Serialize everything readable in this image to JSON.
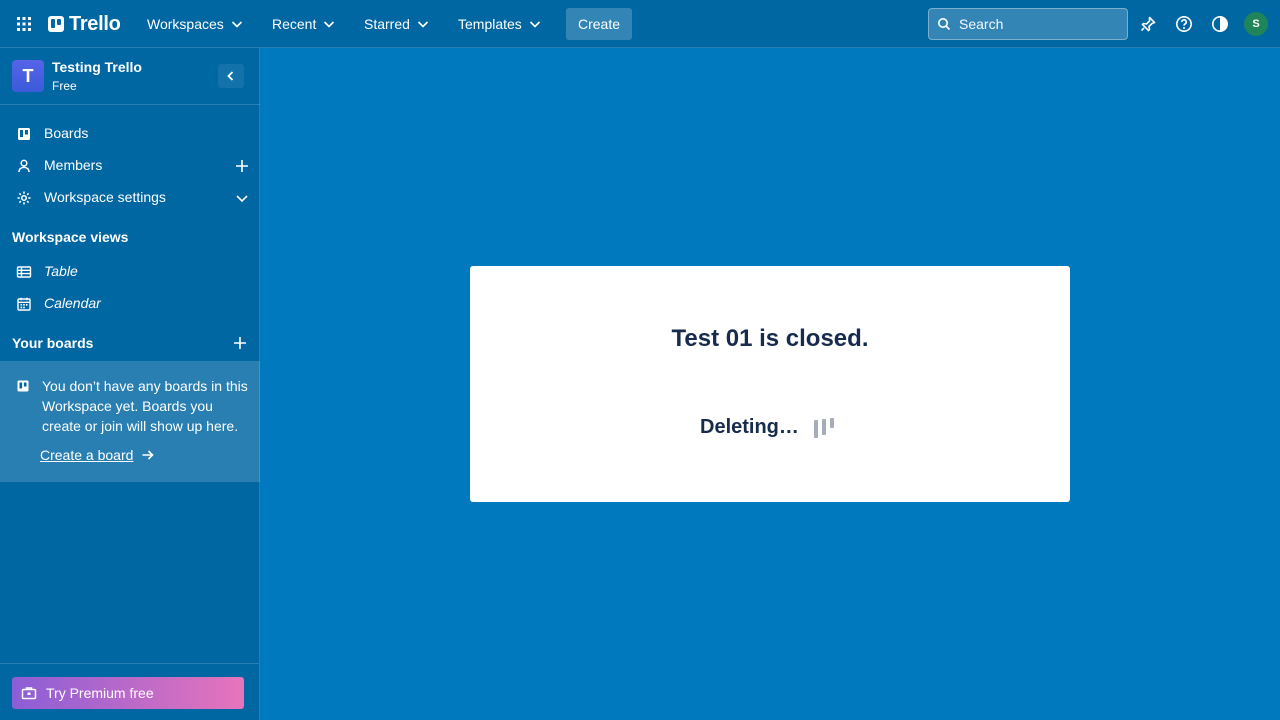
{
  "header": {
    "logo_text": "Trello",
    "nav": [
      {
        "label": "Workspaces"
      },
      {
        "label": "Recent"
      },
      {
        "label": "Starred"
      },
      {
        "label": "Templates"
      }
    ],
    "create_label": "Create",
    "search_placeholder": "Search",
    "avatar_initial": "S"
  },
  "sidebar": {
    "workspace_initial": "T",
    "workspace_name": "Testing Trello",
    "workspace_plan": "Free",
    "items": [
      {
        "label": "Boards",
        "icon": "board-icon"
      },
      {
        "label": "Members",
        "icon": "person-icon"
      },
      {
        "label": "Workspace settings",
        "icon": "gear-icon"
      }
    ],
    "views_title": "Workspace views",
    "views": [
      {
        "label": "Table",
        "icon": "table-icon"
      },
      {
        "label": "Calendar",
        "icon": "calendar-icon"
      }
    ],
    "boards_title": "Your boards",
    "empty_text": "You don’t have any boards in this Workspace yet. Boards you create or join will show up here.",
    "create_board_label": "Create a board",
    "premium_label": "Try Premium free"
  },
  "modal": {
    "title": "Test 01 is closed.",
    "status": "Deleting…"
  },
  "colors": {
    "board_bg": "#0079bf",
    "header_bg": "#0067a3",
    "avatar_bg": "#1f845a"
  }
}
